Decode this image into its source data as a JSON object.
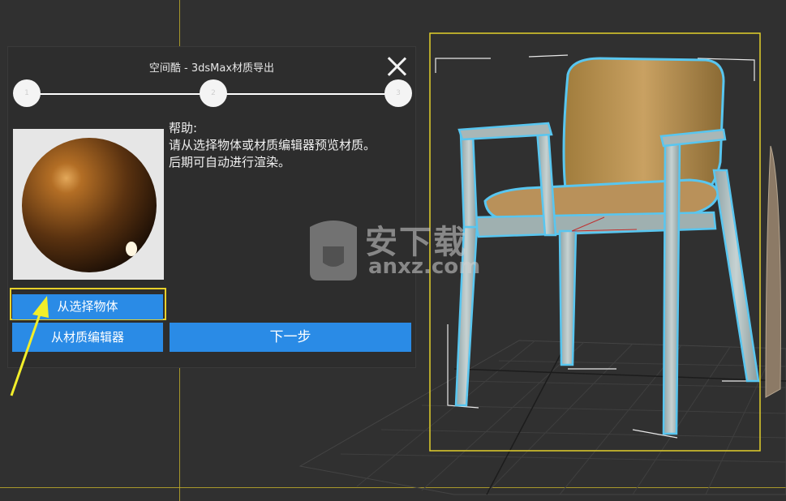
{
  "dialog": {
    "title": "空间酷 - 3dsMax材质导出",
    "steps": [
      "1",
      "2",
      "3"
    ],
    "help_heading": "帮助:",
    "help_line1": "请从选择物体或材质编辑器预览材质。",
    "help_line2": "后期可自动进行渲染。",
    "buttons": {
      "from_selection": "从选择物体",
      "from_editor": "从材质编辑器",
      "next": "下一步"
    }
  },
  "watermark": {
    "cn": "安下载",
    "en": "anxz.com"
  },
  "colors": {
    "accent_blue": "#2a8be6",
    "highlight_yellow": "#e8d12a",
    "viewport_bg": "#303030",
    "dialog_bg": "#2d2d2d"
  },
  "icons": {
    "close": "close-icon",
    "arrow": "pointer-arrow",
    "watermark_logo": "shield-icon"
  }
}
